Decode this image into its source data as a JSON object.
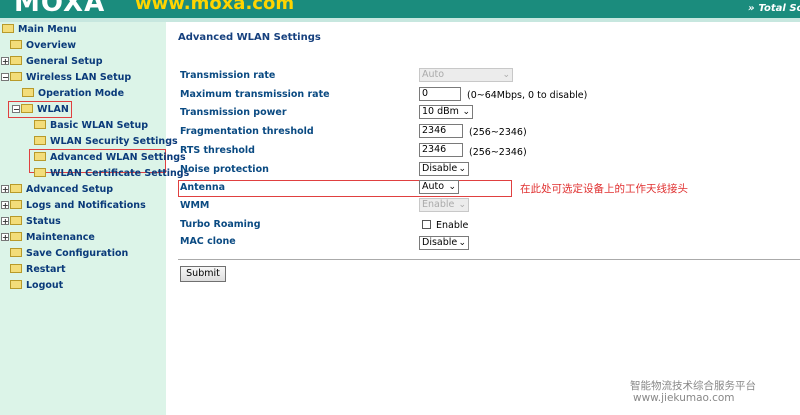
{
  "header": {
    "logo": "MOXA",
    "url": "www.moxa.com",
    "slogan": "Total So"
  },
  "sidebar": {
    "main_menu": "Main Menu",
    "items": [
      {
        "label": "Overview"
      },
      {
        "label": "General Setup"
      },
      {
        "label": "Wireless LAN Setup"
      },
      {
        "label": "Operation Mode"
      },
      {
        "label": "WLAN"
      },
      {
        "label": "Basic WLAN Setup"
      },
      {
        "label": "WLAN Security Settings"
      },
      {
        "label": "Advanced WLAN Settings"
      },
      {
        "label": "WLAN Certificate Settings"
      },
      {
        "label": "Advanced Setup"
      },
      {
        "label": "Logs and Notifications"
      },
      {
        "label": "Status"
      },
      {
        "label": "Maintenance"
      },
      {
        "label": "Save Configuration"
      },
      {
        "label": "Restart"
      },
      {
        "label": "Logout"
      }
    ]
  },
  "main": {
    "title": "Advanced WLAN Settings",
    "fields": {
      "transmission_rate": {
        "label": "Transmission rate",
        "value": "Auto"
      },
      "max_rate": {
        "label": "Maximum transmission rate",
        "value": "0",
        "hint": "(0~64Mbps, 0 to disable)"
      },
      "transmission_power": {
        "label": "Transmission power",
        "value": "10 dBm"
      },
      "fragmentation": {
        "label": "Fragmentation threshold",
        "value": "2346",
        "hint": "(256~2346)"
      },
      "rts": {
        "label": "RTS threshold",
        "value": "2346",
        "hint": "(256~2346)"
      },
      "noise": {
        "label": "Noise protection",
        "value": "Disable"
      },
      "antenna": {
        "label": "Antenna",
        "value": "Auto"
      },
      "wmm": {
        "label": "WMM",
        "value": "Enable"
      },
      "turbo": {
        "label": "Turbo Roaming",
        "checkbox_label": "Enable"
      },
      "mac_clone": {
        "label": "MAC clone",
        "value": "Disable"
      }
    },
    "submit": "Submit",
    "annotation": "在此处可选定设备上的工作天线接头"
  },
  "watermark": {
    "line1": "智能物流技术综合服务平台",
    "line2": "www.jiekumao.com"
  },
  "colors": {
    "header_bg": "#1b8c7d",
    "sidebar_bg": "#dcf4e8",
    "label_blue": "#0a4a82",
    "annotation_red": "#e03030"
  }
}
